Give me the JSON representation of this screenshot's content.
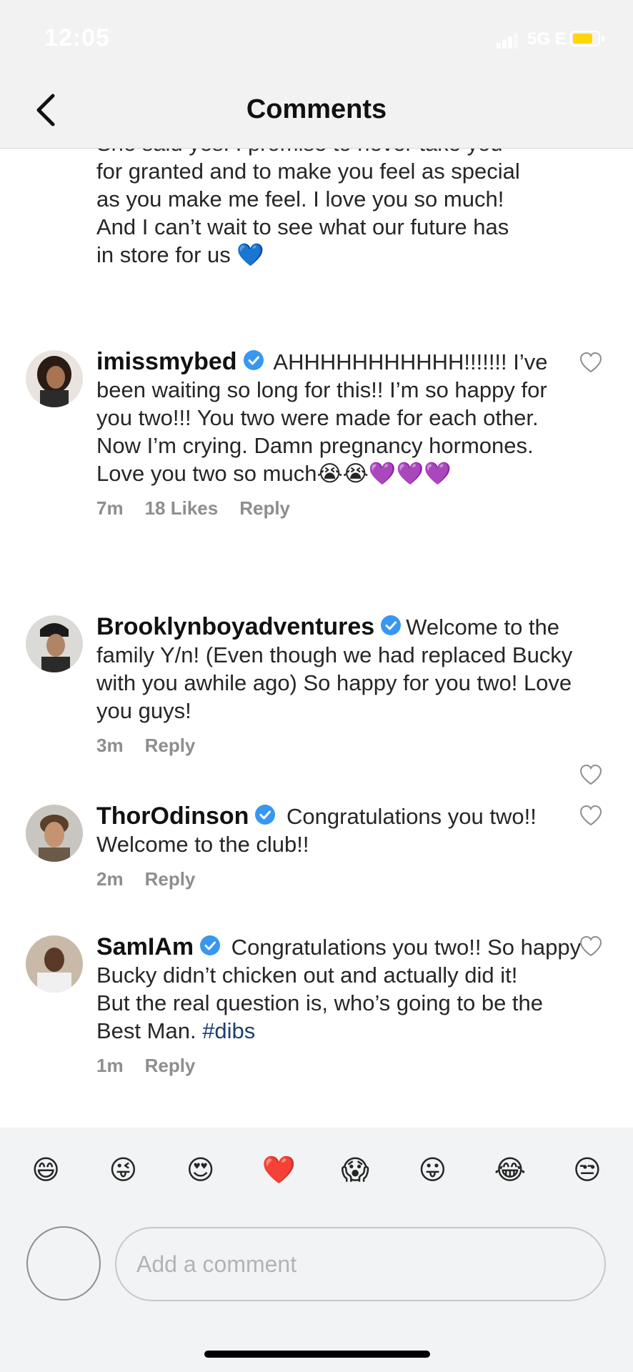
{
  "status_bar": {
    "time": "12:05",
    "network": "5G E"
  },
  "header": {
    "title": "Comments"
  },
  "caption": {
    "text": "She said yes! I promise to never take you\nfor granted and to make you feel as special\nas you make me feel. I love you so much!\nAnd I can’t wait to see what our future has\nin store for us 💙"
  },
  "comments": [
    {
      "username": "imissmybed",
      "text": " AHHHHHHHHHHH!!!!!!! I’ve been waiting so long for this!! I’m so happy for you two!!! You two were made for each other. Now I’m crying. Damn pregnancy hormones. Love you two so much😭😭💜💜💜",
      "time": "7m",
      "likes": "18 Likes",
      "reply": "Reply"
    },
    {
      "username": "Brooklynboyadventures",
      "text": "Welcome to the family Y/n! (Even though we had replaced Bucky with you awhile ago) So happy for you two! Love you guys!",
      "time": "3m",
      "reply": "Reply"
    },
    {
      "username": "ThorOdinson",
      "text": " Congratulations you two!! Welcome to the club!!",
      "time": "2m",
      "reply": "Reply"
    },
    {
      "username": "SamIAm",
      "text": " Congratulations you two!! So happy Bucky didn’t chicken out and actually did it!",
      "text2": "But the real question is, who’s going to be the Best Man. ",
      "hashtag": "#dibs",
      "time": "1m",
      "reply": "Reply"
    }
  ],
  "emoji_bar": [
    "😄",
    "😜",
    "😍",
    "❤️",
    "😱",
    "😛",
    "😂",
    "😒"
  ],
  "composer": {
    "placeholder": "Add a comment"
  },
  "colors": {
    "verified": "#3897f0",
    "hashtag": "#1b3f6e",
    "meta": "#8e8e8e"
  }
}
